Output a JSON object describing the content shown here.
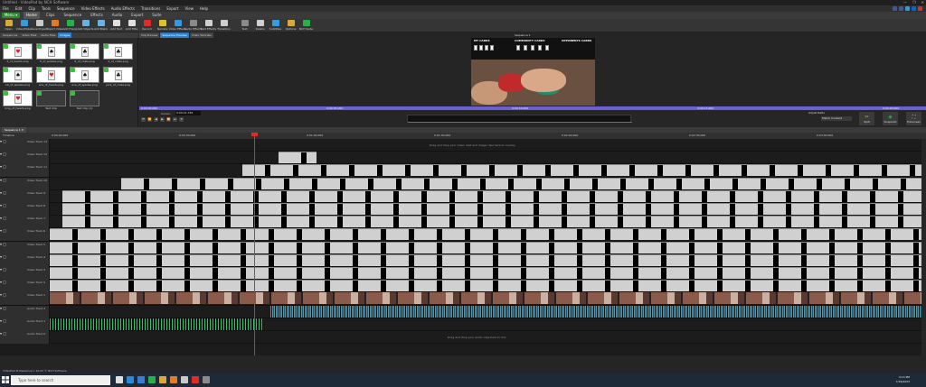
{
  "window": {
    "title": "Untitled - VideoPad by NCH Software",
    "controls": [
      "—",
      "❐",
      "✕"
    ]
  },
  "menubar": [
    "File",
    "Edit",
    "Clip",
    "Tools",
    "Sequence",
    "Video Effects",
    "Audio Effects",
    "Transitions",
    "Export",
    "View",
    "Help"
  ],
  "menu_button": "Menu ▾",
  "tabs": [
    {
      "label": "Home",
      "active": true
    },
    {
      "label": "Clips"
    },
    {
      "label": "Sequence"
    },
    {
      "label": "Effects"
    },
    {
      "label": "Audio"
    },
    {
      "label": "Export"
    },
    {
      "label": "Suite"
    }
  ],
  "ribbon": [
    {
      "label": "Open",
      "color": "#d9a93a"
    },
    {
      "label": "Video/Mixer",
      "color": "#3a9ad9"
    },
    {
      "label": "Save Project",
      "color": "#c9c9c9"
    },
    {
      "label": "Import Video",
      "color": "#e07b2a"
    },
    {
      "label": "Add File(s)",
      "color": "#2ab04a"
    },
    {
      "label": "Add Objects",
      "color": "#6ab0e0"
    },
    {
      "label": "Add Blank",
      "color": "#6ab0e0"
    },
    {
      "label": "Add Text",
      "color": "#e0e0e0"
    },
    {
      "label": "Add Title",
      "color": "#e0e0e0"
    },
    {
      "label": "Record",
      "color": "#e02b2b"
    },
    {
      "label": "Narrate",
      "color": "#e0c02b"
    },
    {
      "label": "Video Effects",
      "color": "#3a9ad9"
    },
    {
      "label": "Audio Effects",
      "color": "#8a8a8a"
    },
    {
      "label": "Text Effects",
      "color": "#cfcfcf"
    },
    {
      "label": "Transition",
      "color": "#cfcfcf"
    },
    {
      "label": "Text",
      "color": "#8a8a8a"
    },
    {
      "label": "Delete",
      "color": "#cfcfcf"
    },
    {
      "label": "Subtitles",
      "color": "#3a9ad9"
    },
    {
      "label": "Options",
      "color": "#d9a93a"
    },
    {
      "label": "NCH Suite",
      "color": "#2ab04a"
    }
  ],
  "social_colors": [
    "#3b5998",
    "#3b5998",
    "#1da1f2",
    "#0a66c2",
    "#e02b2b"
  ],
  "bin": {
    "tabs": [
      {
        "label": "Sequences"
      },
      {
        "label": "Video Files"
      },
      {
        "label": "Audio Files"
      },
      {
        "label": "Images",
        "active": true
      }
    ],
    "items": [
      {
        "label": "5_of_hearts.png",
        "glyph": "♥"
      },
      {
        "label": "5_of_spades.png",
        "glyph": "♠"
      },
      {
        "label": "5_of_clubs.png",
        "glyph": "♣"
      },
      {
        "label": "2_of_clubs.png",
        "glyph": "♣"
      },
      {
        "label": "10_of_spades.png",
        "glyph": "♠"
      },
      {
        "label": "ace_of_hearts.png",
        "glyph": "♥"
      },
      {
        "label": "ace_of_spades.png",
        "glyph": "♠"
      },
      {
        "label": "jack_of_clubs.png",
        "glyph": "♣"
      },
      {
        "label": "king_of_hearts.png",
        "glyph": "♥"
      },
      {
        "label": "Text Clip",
        "glyph": ""
      },
      {
        "label": "Text Clip (1)",
        "glyph": ""
      }
    ]
  },
  "preview": {
    "tabs": [
      "Clip Preview",
      "Sequence Preview",
      "Video Tutorials"
    ],
    "sequence_title": "Sequence 1",
    "video_headers": [
      "MY CARDS",
      "COMMUNITY CARDS",
      "OPPONENTS CARDS"
    ],
    "cursor_label": "Cursor:",
    "cursor_value": "0:00:21.746",
    "ruler": [
      "0:00:00.000",
      "0:00:05.000",
      "0:00:10.000",
      "0:00:15.000",
      "0:00:20.000"
    ],
    "transport": [
      "⏮",
      "⏪",
      "◀",
      "▶",
      "⏩",
      "⏭",
      "⟲"
    ],
    "aspect_label": "Adjust Ratio",
    "aspect_value": "Match Content",
    "big_buttons": [
      "Split",
      "Snapshot",
      "Fullscreen"
    ]
  },
  "timeline": {
    "sequence_tab": "Sequence 1 ✕",
    "ruler": [
      "Timeline",
      "0:00:00.000",
      "0:00:30.000",
      "0:01:00.000",
      "0:01:30.000",
      "0:02:00.000",
      "0:02:30.000",
      "0:03:00.000"
    ],
    "tracks": [
      {
        "name": "Video Track 13",
        "kind": "empty"
      },
      {
        "name": "Video Track 12",
        "kind": "short",
        "start": 253,
        "width": 42
      },
      {
        "name": "Video Track 11",
        "kind": "clips",
        "start": 213
      },
      {
        "name": "Video Track 10",
        "kind": "clips",
        "start": 79
      },
      {
        "name": "Video Track 9",
        "kind": "clips",
        "start": 14
      },
      {
        "name": "Video Track 8",
        "kind": "clips",
        "start": 14
      },
      {
        "name": "Video Track 7",
        "kind": "clips",
        "start": 14
      },
      {
        "name": "Video Track 6",
        "kind": "clips",
        "start": 0
      },
      {
        "name": "Video Track 5",
        "kind": "clips",
        "start": 0
      },
      {
        "name": "Video Track 4",
        "kind": "clips",
        "start": 0
      },
      {
        "name": "Video Track 3",
        "kind": "clips",
        "start": 0
      },
      {
        "name": "Video Track 2",
        "kind": "clips",
        "start": 0
      },
      {
        "name": "Video Track 1",
        "kind": "video",
        "start": 0
      },
      {
        "name": "Audio Track 2",
        "kind": "audio",
        "start": 244
      },
      {
        "name": "Audio Track 1",
        "kind": "audio2",
        "start": 0,
        "width": 236
      },
      {
        "name": "Audio Track 0",
        "kind": "empty"
      }
    ],
    "video_drop_hint": "Drag and drop your video, text and image clips here to overlay",
    "audio_drop_hint": "Drag and drop your audio clips here to mix"
  },
  "status": "VideoPad Professional v 10.63 © NCH Software",
  "taskbar": {
    "search_placeholder": "Type here to search",
    "time": "4:13 PM",
    "date": "7/16/2023",
    "icon_colors": [
      "#e0e0e0",
      "#2a8ad9",
      "#3a7bd5",
      "#2ab04a",
      "#d9a93a",
      "#e07b2a",
      "#c9c9c9",
      "#e02b2b",
      "#8a8a8a"
    ]
  }
}
